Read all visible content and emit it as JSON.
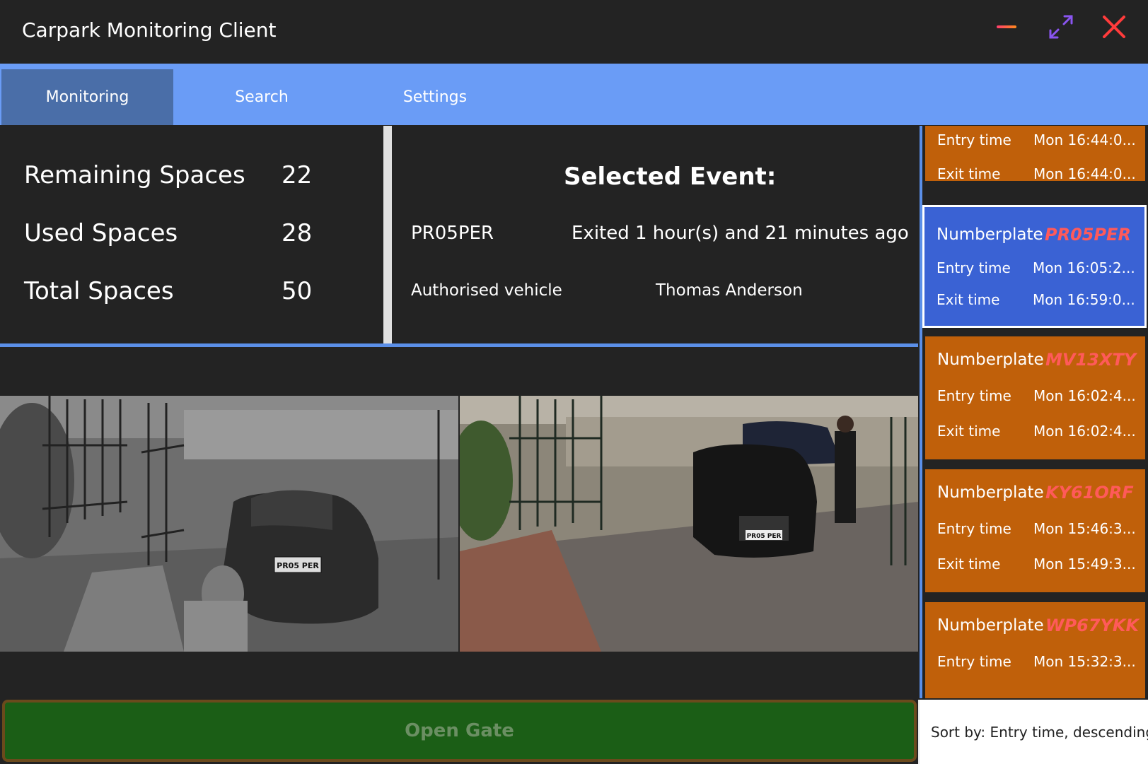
{
  "window": {
    "title": "Carpark Monitoring Client",
    "minimize_icon": "minimize-icon",
    "maximize_icon": "maximize-icon",
    "close_icon": "close-icon"
  },
  "tabs": [
    {
      "label": "Monitoring",
      "active": true
    },
    {
      "label": "Search",
      "active": false
    },
    {
      "label": "Settings",
      "active": false
    }
  ],
  "stats": {
    "remaining_label": "Remaining Spaces",
    "remaining_value": "22",
    "used_label": "Used Spaces",
    "used_value": "28",
    "total_label": "Total Spaces",
    "total_value": "50"
  },
  "selected_event": {
    "title": "Selected Event:",
    "numberplate": "PR05PER",
    "status": "Exited 1 hour(s) and 21 minutes ago",
    "authorisation": "Authorised vehicle",
    "owner": "Thomas Anderson"
  },
  "cameras": {
    "left_plate": "PR05 PER",
    "right_plate": "PR05 PER"
  },
  "open_gate_label": "Open Gate",
  "event_list": {
    "numberplate_label": "Numberplate",
    "entry_label": "Entry time",
    "exit_label": "Exit time",
    "cards": [
      {
        "numberplate": "",
        "entry": "Mon 16:44:0...",
        "exit": "Mon 16:44:0...",
        "selected": false
      },
      {
        "numberplate": "PR05PER",
        "entry": "Mon 16:05:2...",
        "exit": "Mon 16:59:0...",
        "selected": true
      },
      {
        "numberplate": "MV13XTY",
        "entry": "Mon 16:02:4...",
        "exit": "Mon 16:02:4...",
        "selected": false
      },
      {
        "numberplate": "KY61ORF",
        "entry": "Mon 15:46:3...",
        "exit": "Mon 15:49:3...",
        "selected": false
      },
      {
        "numberplate": "WP67YKK",
        "entry": "Mon 15:32:3...",
        "exit": "",
        "selected": false
      }
    ]
  },
  "sort_label": "Sort by: Entry time, descending",
  "colors": {
    "background": "#232323",
    "tab_bar": "#6a9cf6",
    "tab_active": "#4a6ea8",
    "card": "#c0600a",
    "card_selected": "#3a62d4",
    "plate_text": "#ff5a5a",
    "open_gate": "#1b5e16"
  }
}
